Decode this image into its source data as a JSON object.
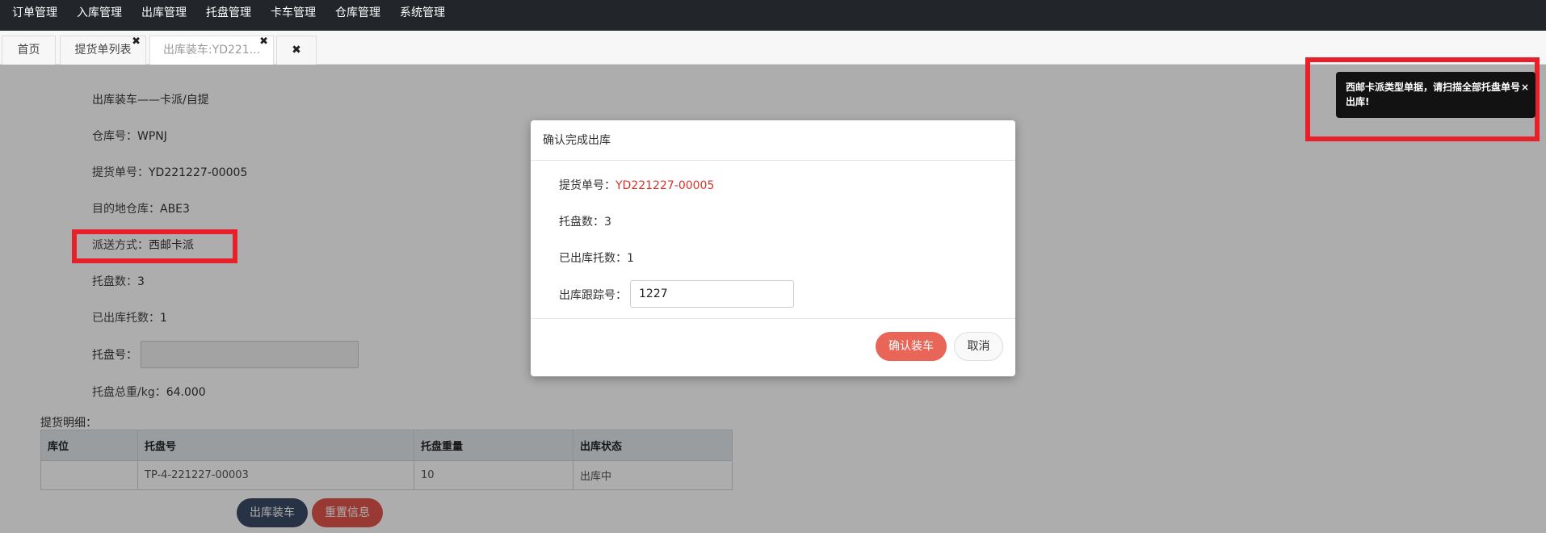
{
  "nav": {
    "items": [
      "订单管理",
      "入库管理",
      "出库管理",
      "托盘管理",
      "卡车管理",
      "仓库管理",
      "系统管理"
    ]
  },
  "tabs": [
    {
      "label": "首页"
    },
    {
      "label": "提货单列表"
    },
    {
      "label": "出库装车:YD221..."
    }
  ],
  "tab_close_glyph": "✖",
  "page": {
    "title": "出库装车——卡派/自提",
    "warehouse_label": "仓库号：",
    "warehouse_value": "WPNJ",
    "bol_label": "提货单号：",
    "bol_value": "YD221227-00005",
    "dest_label": "目的地仓库：",
    "dest_value": "ABE3",
    "delivery_label": "派送方式：",
    "delivery_value": "西邮卡派",
    "pallet_count_label": "托盘数：",
    "pallet_count_value": "3",
    "shipped_label": "已出库托数：",
    "shipped_value": "1",
    "pallet_no_label": "托盘号：",
    "pallet_no_value": "",
    "total_weight_label": "托盘总重/kg：",
    "total_weight_value": "64.000",
    "detail_label": "提货明细："
  },
  "table": {
    "headers": [
      "库位",
      "托盘号",
      "托盘重量",
      "出库状态"
    ],
    "rows": [
      [
        "",
        "TP-4-221227-00003",
        "10",
        "出库中"
      ]
    ]
  },
  "buttons": {
    "load": "出库装车",
    "reset": "重置信息"
  },
  "modal": {
    "title": "确认完成出库",
    "bol_label": "提货单号：",
    "bol_value": "YD221227-00005",
    "pallet_count_label": "托盘数：",
    "pallet_count_value": "3",
    "shipped_label": "已出库托数：",
    "shipped_value": "1",
    "tracking_label": "出库跟踪号：",
    "tracking_value": "1227",
    "confirm": "确认装车",
    "cancel": "取消"
  },
  "toast": {
    "message": "西邮卡派类型单据，请扫描全部托盘单号出库!",
    "close": "×"
  },
  "colors": {
    "nav_bg": "#22262a",
    "highlight": "#e8202a",
    "accent_red": "#d9332b",
    "confirm_btn": "#e96558",
    "load_btn": "#3a4a66",
    "reset_btn": "#e0544c"
  }
}
